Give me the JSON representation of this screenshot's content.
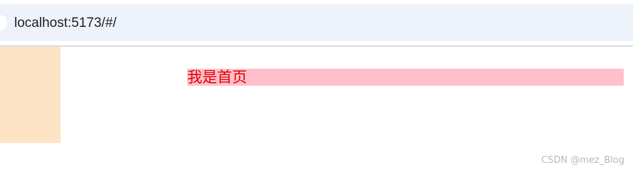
{
  "browser": {
    "url": "localhost:5173/#/"
  },
  "main": {
    "home_text": "我是首页"
  },
  "watermark": {
    "text": "CSDN @mez_Blog"
  },
  "colors": {
    "sidebar_bg": "#fde3c5",
    "banner_bg": "#ffc0cb",
    "banner_text": "#e00000",
    "address_bar_bg": "#eef2fa"
  }
}
